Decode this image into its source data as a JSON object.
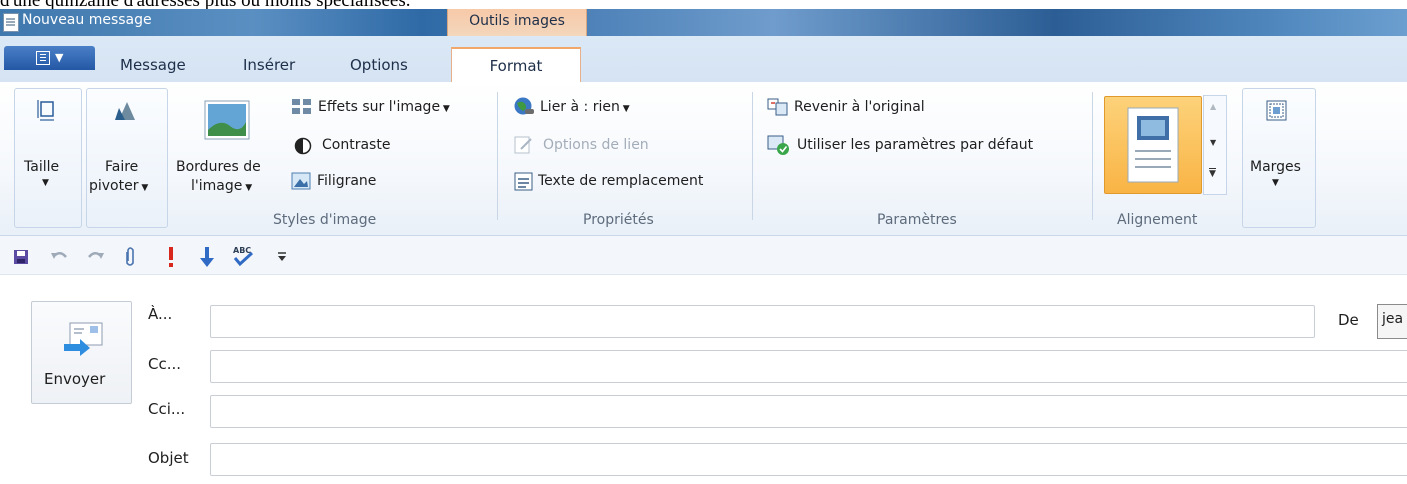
{
  "top_snippet": "d'une quinzaine d'adresses plus ou moins spécialisées.",
  "window": {
    "title": "Nouveau message",
    "context_tab": "Outils images"
  },
  "tabs": {
    "message": "Message",
    "inserer": "Insérer",
    "options": "Options",
    "format": "Format"
  },
  "ribbon": {
    "taille": "Taille",
    "faire_pivoter_1": "Faire",
    "faire_pivoter_2": "pivoter",
    "bordures_1": "Bordures de",
    "bordures_2": "l'image",
    "effets": "Effets sur l'image",
    "contraste": "Contraste",
    "filigrane": "Filigrane",
    "styles_group": "Styles d'image",
    "lier": "Lier à : rien",
    "options_lien": "Options de lien",
    "texte_remplacement": "Texte de remplacement",
    "proprietes_group": "Propriétés",
    "revenir": "Revenir à l'original",
    "utiliser": "Utiliser les paramètres par défaut",
    "parametres_group": "Paramètres",
    "alignement_group": "Alignement",
    "marges": "Marges"
  },
  "compose": {
    "send": "Envoyer",
    "to": "À...",
    "cc": "Cc...",
    "bcc": "Cci...",
    "subject": "Objet",
    "from_label": "De",
    "from_value": "jea"
  },
  "colors": {
    "accent_blue": "#2458a6",
    "context_orange": "#f3c9a6",
    "selected_orange": "#fbb74e"
  },
  "icons": [
    "document-icon",
    "file-menu-icon",
    "size-icon",
    "rotate-icon",
    "border-image-icon",
    "effects-icon",
    "contrast-icon",
    "watermark-icon",
    "link-globe-icon",
    "link-options-icon",
    "alt-text-icon",
    "revert-icon",
    "defaults-icon",
    "alignment-icon",
    "margins-icon",
    "save-icon",
    "undo-icon",
    "redo-icon",
    "attach-icon",
    "high-priority-icon",
    "low-priority-icon",
    "spellcheck-icon",
    "customize-icon",
    "send-icon"
  ]
}
